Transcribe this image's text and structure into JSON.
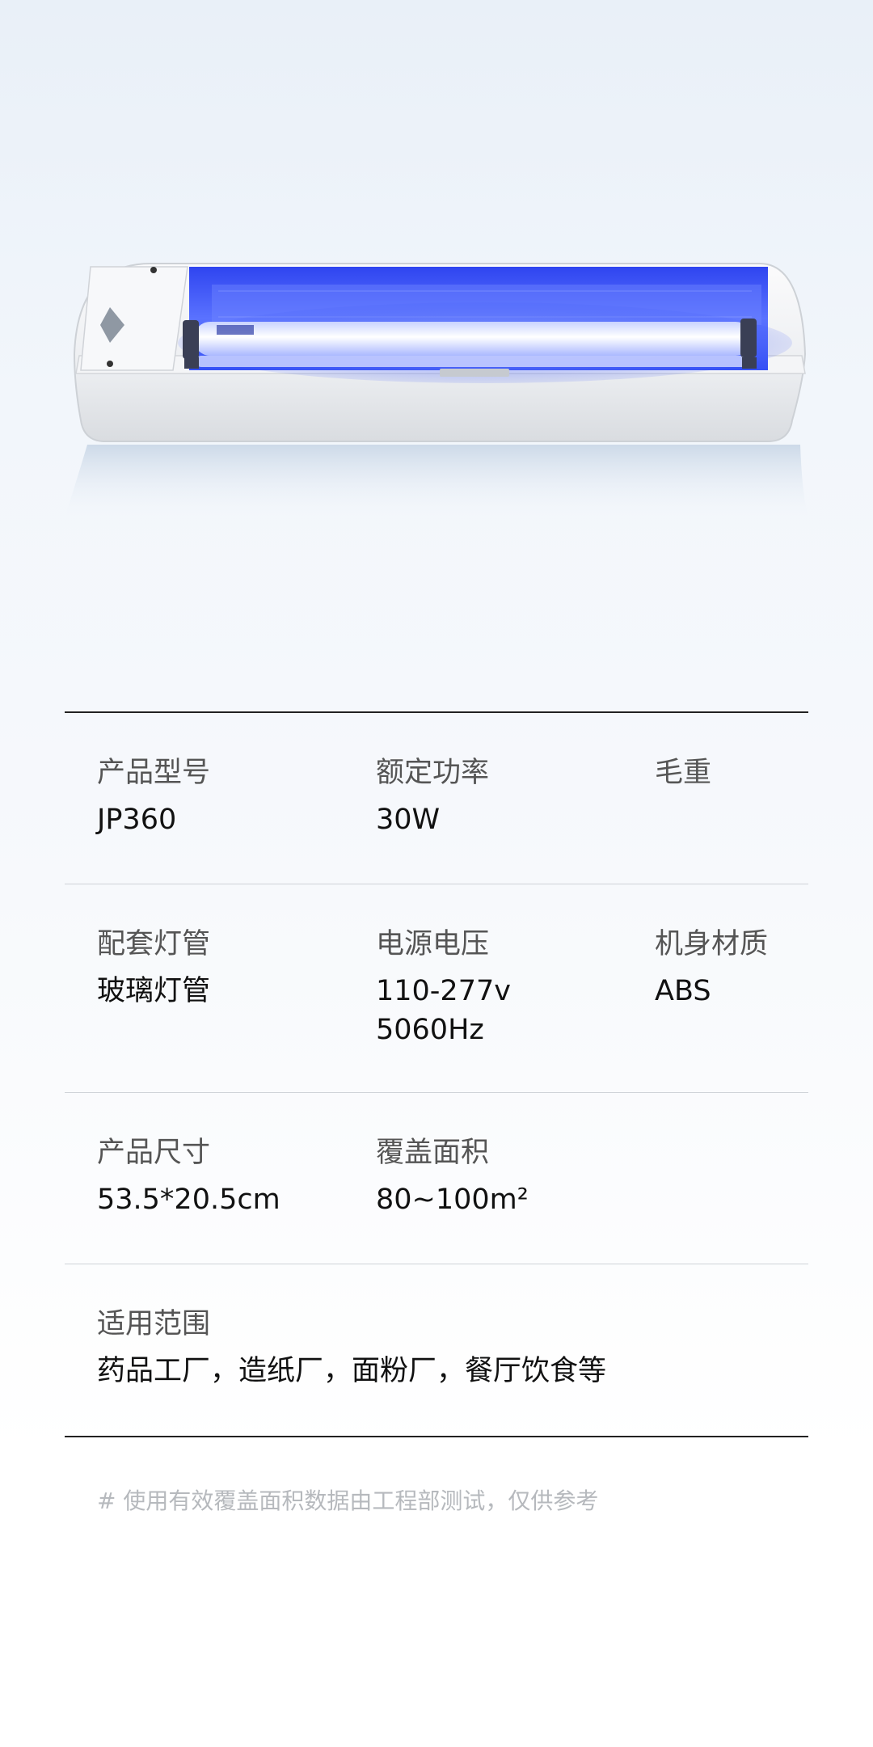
{
  "product_image": {
    "icon": "uv-lamp-fixture",
    "accent_color": "#3d5cff"
  },
  "specs": {
    "rows": [
      [
        {
          "label": "产品型号",
          "value": "JP360"
        },
        {
          "label": "额定功率",
          "value": "30W"
        },
        {
          "label": "毛重",
          "value": ""
        }
      ],
      [
        {
          "label": "配套灯管",
          "value": "玻璃灯管"
        },
        {
          "label": "电源电压",
          "value": "110-277v\n5060Hz"
        },
        {
          "label": "机身材质",
          "value": "ABS"
        }
      ],
      [
        {
          "label": "产品尺寸",
          "value": "53.5*20.5cm"
        },
        {
          "label": "覆盖面积",
          "value": "80~100m²"
        }
      ],
      [
        {
          "label": "适用范围",
          "value": "药品工厂，造纸厂，面粉厂，餐厅饮食等"
        }
      ]
    ]
  },
  "footnote": "# 使用有效覆盖面积数据由工程部测试，仅供参考"
}
